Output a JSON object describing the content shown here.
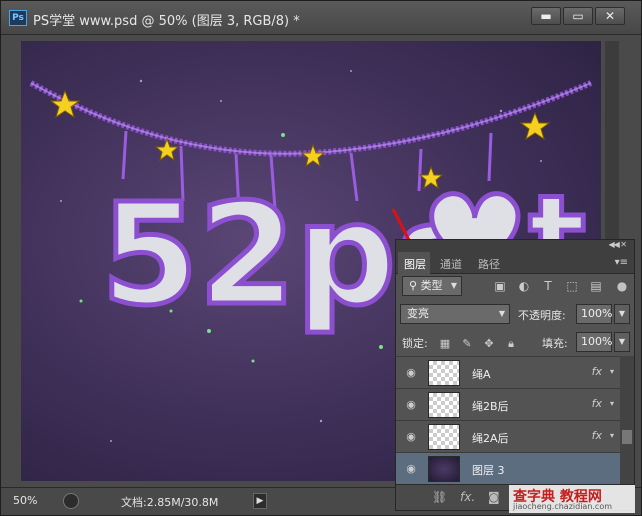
{
  "window": {
    "title": "PS学堂 www.psd @ 50% (图层 3, RGB/8) *",
    "app_icon_text": "Ps",
    "controls": [
      "minimize",
      "maximize",
      "close"
    ]
  },
  "canvas": {
    "artwork_text": "52ps",
    "icons": [
      "star-icon"
    ]
  },
  "status_bar": {
    "zoom": "50%",
    "doc_info": "文档:2.85M/30.8M",
    "arrow": "▶"
  },
  "layers_panel": {
    "tabs": [
      {
        "label": "图层",
        "active": true
      },
      {
        "label": "通道",
        "active": false
      },
      {
        "label": "路径",
        "active": false
      }
    ],
    "filter_kind": "类型",
    "blend_mode": "变亮",
    "opacity_label": "不透明度:",
    "opacity_value": "100%",
    "lock_label": "锁定:",
    "fill_label": "填充:",
    "fill_value": "100%",
    "layers": [
      {
        "name": "绳A",
        "fx": "fx",
        "selected": false
      },
      {
        "name": "绳2B后",
        "fx": "fx",
        "selected": false
      },
      {
        "name": "绳2A后",
        "fx": "fx",
        "selected": false
      },
      {
        "name": "图层 3",
        "fx": "",
        "selected": true
      }
    ],
    "footer_icons": [
      "link-icon",
      "fx-icon",
      "mask-icon"
    ]
  },
  "watermark": {
    "main": "查字典 教程网",
    "sub": "jiaocheng.chazidian.com"
  },
  "colors": {
    "accent_selected": "#5d6d80",
    "canvas_purple": "#3e2f57",
    "rope_purple": "#8b4fd0",
    "star_yellow": "#f5d020",
    "arrow_red": "#e01010"
  }
}
